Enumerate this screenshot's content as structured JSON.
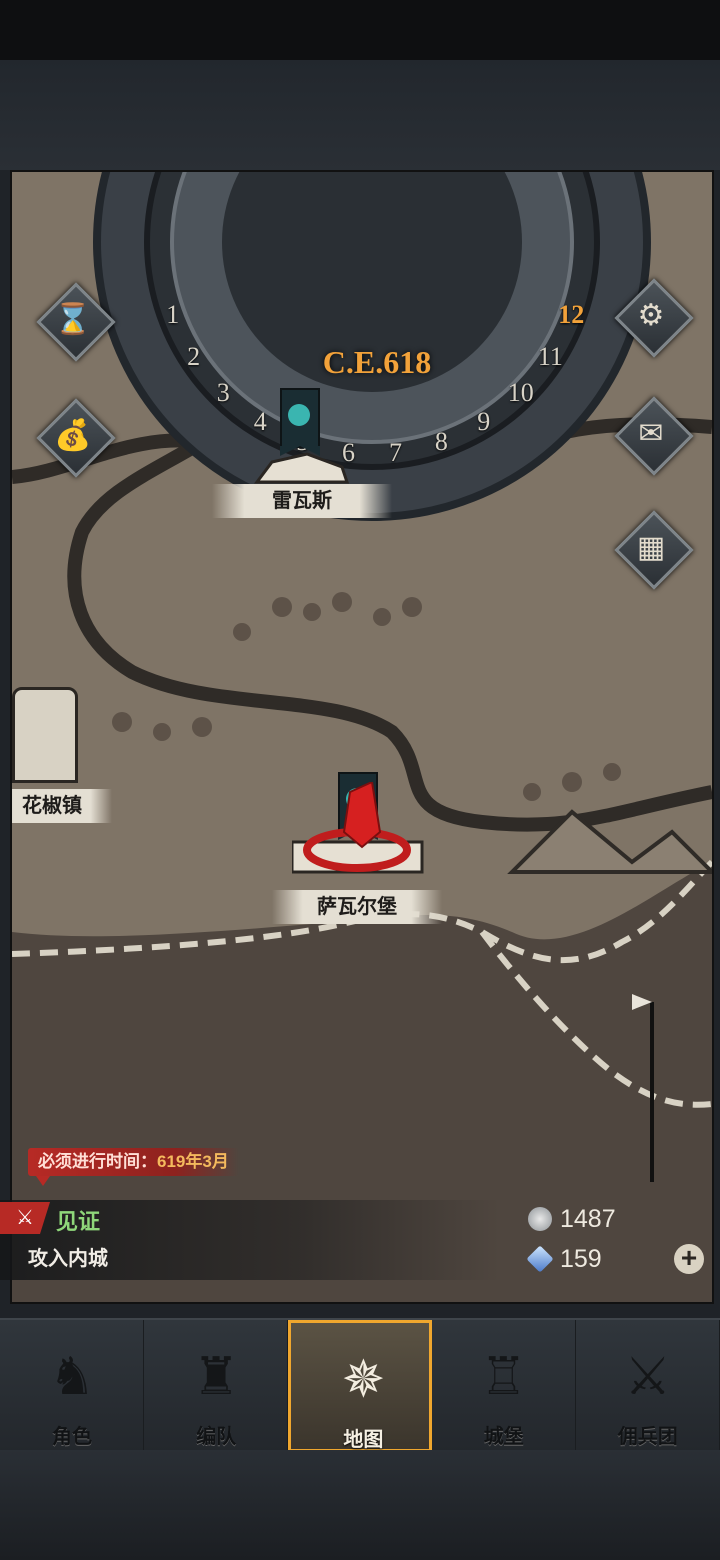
{
  "calendar": {
    "era": "C.E.618",
    "months": [
      "1",
      "2",
      "3",
      "4",
      "5",
      "6",
      "7",
      "8",
      "9",
      "10",
      "11",
      "12"
    ],
    "current_month": "12"
  },
  "side_buttons": {
    "left": [
      {
        "name": "hourglass-icon",
        "glyph": "⌛"
      },
      {
        "name": "money-bag-icon",
        "glyph": "💰"
      }
    ],
    "right": [
      {
        "name": "gear-icon",
        "glyph": "⚙"
      },
      {
        "name": "mail-icon",
        "glyph": "✉"
      },
      {
        "name": "grid-icon",
        "glyph": "▦"
      }
    ]
  },
  "locations": {
    "revas": "雷瓦斯",
    "pepper_town": "花椒镇",
    "savaar_fort": "萨瓦尔堡"
  },
  "deadline": {
    "label": "必须进行时间：",
    "value": "619年3月"
  },
  "quest": {
    "title": "见证",
    "subtitle": "攻入内城"
  },
  "resources": {
    "silver": "1487",
    "crystal": "159"
  },
  "nav": [
    {
      "label": "角色",
      "icon": "knight-icon",
      "glyph": "♞"
    },
    {
      "label": "编队",
      "icon": "helmet-icon",
      "glyph": "♜"
    },
    {
      "label": "地图",
      "icon": "compass-icon",
      "glyph": "✵"
    },
    {
      "label": "城堡",
      "icon": "castle-icon",
      "glyph": "♖"
    },
    {
      "label": "佣兵团",
      "icon": "mercenary-icon",
      "glyph": "⚔"
    }
  ],
  "active_nav": 2,
  "colors": {
    "accent": "#f2a23a",
    "quest_title": "#8fd77a",
    "alert": "#b72a25"
  }
}
